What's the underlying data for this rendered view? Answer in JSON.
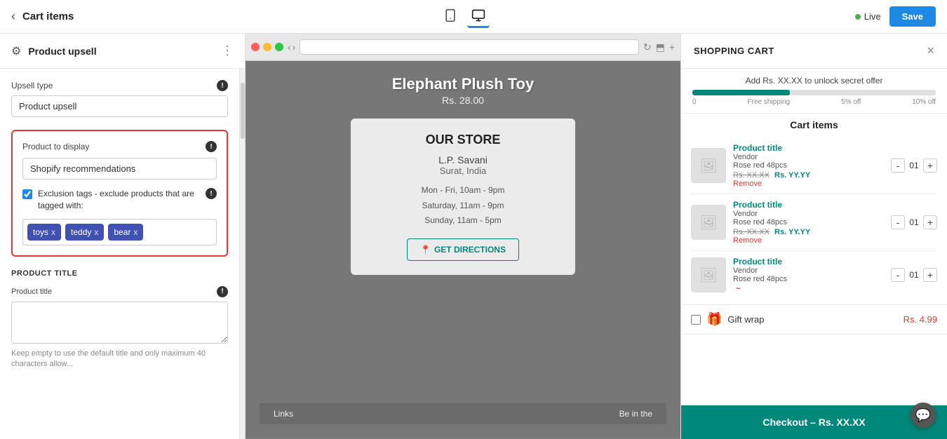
{
  "topbar": {
    "back_label": "‹",
    "title": "Cart items",
    "live_label": "Live",
    "save_label": "Save"
  },
  "left_panel": {
    "section_title": "Product upsell",
    "upsell_type_label": "Upsell type",
    "upsell_type_info": "!",
    "upsell_type_value": "Product upsell",
    "product_display_label": "Product to display",
    "product_display_info": "!",
    "product_display_value": "Shopify recommendations",
    "exclusion_checkbox_label": "Exclusion tags - exclude products that are tagged with:",
    "exclusion_info": "!",
    "tags": [
      {
        "label": "toys"
      },
      {
        "label": "teddy"
      },
      {
        "label": "bear"
      }
    ],
    "product_title_section": "PRODUCT TITLE",
    "product_title_label": "Product title",
    "product_title_info": "!",
    "product_title_placeholder": "",
    "product_title_hint": "Keep empty to use the default title and only maximum 40 characters allow..."
  },
  "preview": {
    "product_name": "Elephant Plush Toy",
    "product_price": "Rs. 28.00",
    "store_title": "OUR STORE",
    "store_name": "L.P. Savani",
    "store_location": "Surat, India",
    "hours_1": "Mon - Fri, 10am - 9pm",
    "hours_2": "Saturday, 11am - 9pm",
    "hours_3": "Sunday, 11am - 5pm",
    "directions_label": "GET DIRECTIONS",
    "footer_links": "Links",
    "footer_be": "Be in the"
  },
  "cart_panel": {
    "title": "SHOPPING CART",
    "close_label": "×",
    "unlock_text": "Add Rs. XX.XX to unlock secret offer",
    "progress_labels": [
      "0",
      "Free shipping",
      "5% off",
      "10% off"
    ],
    "cart_items_title": "Cart items",
    "items": [
      {
        "title": "Product title",
        "vendor": "Vendor",
        "variant": "Rose red 48pcs",
        "price_original": "Rs. XX.XX",
        "price_sale": "Rs. YY.YY",
        "qty": "01",
        "remove": "Remove"
      },
      {
        "title": "Product title",
        "vendor": "Vendor",
        "variant": "Rose red 48pcs",
        "price_original": "Rs. XX.XX",
        "price_sale": "Rs. YY.YY",
        "qty": "01",
        "remove": "Remove"
      },
      {
        "title": "Product title",
        "vendor": "Vendor",
        "variant": "Rose red 48pcs",
        "price_original": "",
        "price_sale": "~",
        "qty": "01",
        "remove": ""
      }
    ],
    "gift_wrap_label": "Gift wrap",
    "gift_wrap_price": "Rs. 4.99",
    "checkout_label": "Checkout – Rs. XX.XX"
  }
}
